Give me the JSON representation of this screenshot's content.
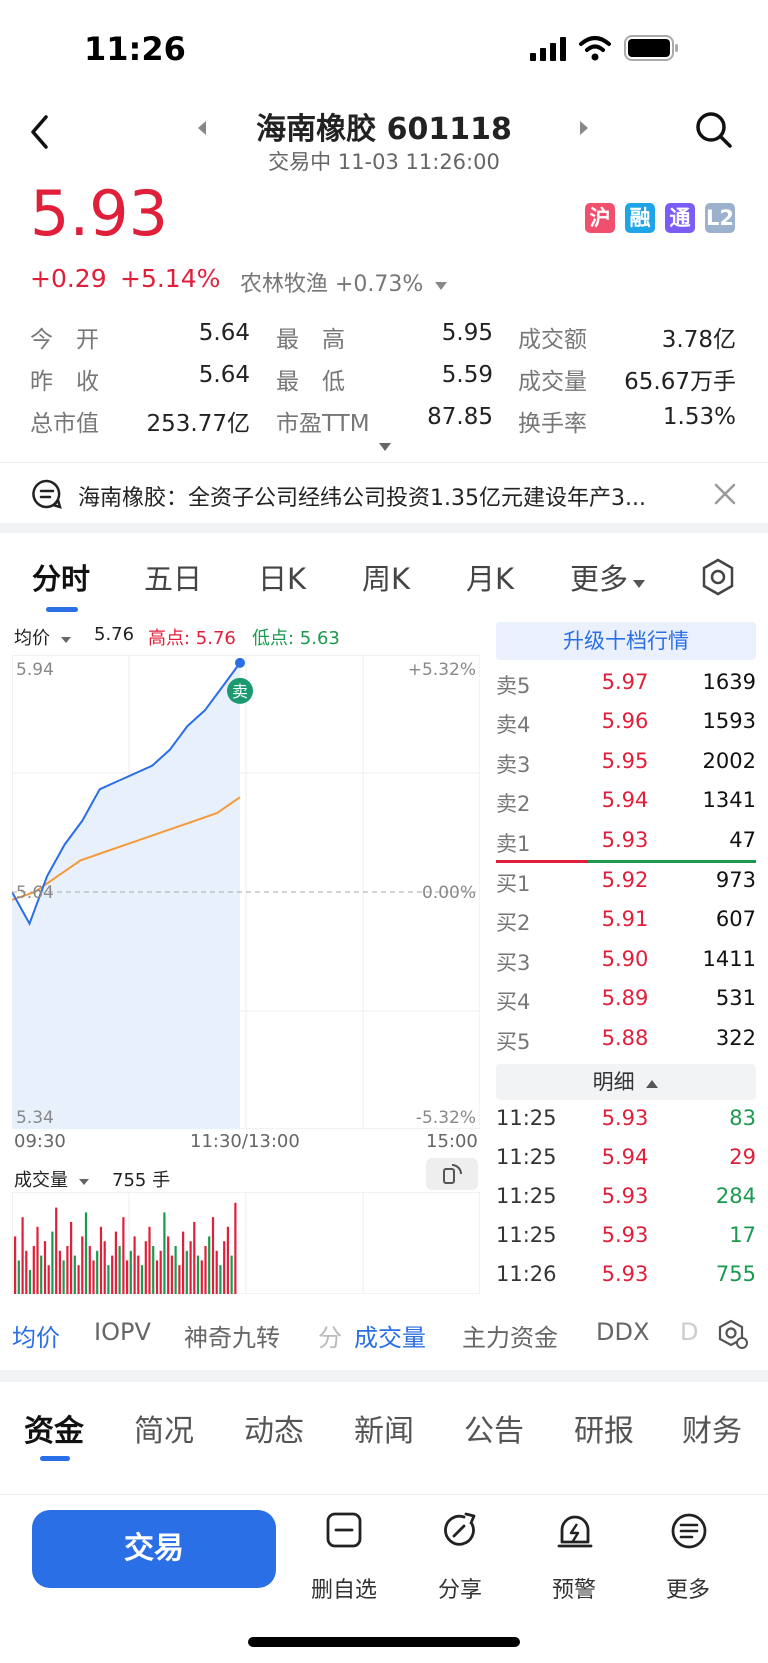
{
  "status_bar": {
    "time": "11:26"
  },
  "header": {
    "title": "海南橡胶 601118",
    "subtitle": "交易中 11-03 11:26:00"
  },
  "badges": [
    {
      "text": "沪",
      "color": "#f0506e"
    },
    {
      "text": "融",
      "color": "#1fa4e8"
    },
    {
      "text": "通",
      "color": "#7b5cf5"
    },
    {
      "text": "L2",
      "color": "#9bb1cc"
    }
  ],
  "quote": {
    "price": "5.93",
    "change": "+0.29",
    "change_pct": "+5.14%",
    "sector": "农林牧渔 +0.73%"
  },
  "stats": [
    {
      "label": "今　开",
      "value": "5.64",
      "color": "#222"
    },
    {
      "label": "最　高",
      "value": "5.95",
      "color": "#e0203a"
    },
    {
      "label": "成交额",
      "value": "3.78亿",
      "color": "#222"
    },
    {
      "label": "昨　收",
      "value": "5.64",
      "color": "#222"
    },
    {
      "label": "最　低",
      "value": "5.59",
      "color": "#1a9a4e"
    },
    {
      "label": "成交量",
      "value": "65.67万手",
      "color": "#222"
    },
    {
      "label": "总市值",
      "value": "253.77亿",
      "color": "#222"
    },
    {
      "label": "市盈TTM",
      "value": "87.85",
      "color": "#222"
    },
    {
      "label": "换手率",
      "value": "1.53%",
      "color": "#222"
    }
  ],
  "news": {
    "text": "海南橡胶：全资子公司经纬公司投资1.35亿元建设年产3..."
  },
  "kline_tabs": [
    "分时",
    "五日",
    "日K",
    "周K",
    "月K",
    "更多"
  ],
  "chart_header": {
    "avg_label": "均价",
    "avg_value": "5.76",
    "high_label": "高点: 5.76",
    "low_label": "低点: 5.63"
  },
  "chart_data": {
    "type": "line",
    "y_left_labels": [
      "5.94",
      "5.64",
      "5.34"
    ],
    "y_right_labels": [
      "+5.32%",
      "0.00%",
      "-5.32%"
    ],
    "x_labels": [
      "09:30",
      "11:30/13:00",
      "15:00"
    ],
    "ylim": [
      5.34,
      5.94
    ],
    "series": [
      {
        "values": [
          5.64,
          5.6,
          5.66,
          5.7,
          5.73,
          5.77,
          5.78,
          5.79,
          5.8,
          5.82,
          5.85,
          5.87,
          5.9,
          5.93
        ],
        "color": "#2b6fe6"
      },
      {
        "values": [
          5.63,
          5.64,
          5.66,
          5.68,
          5.69,
          5.7,
          5.71,
          5.72,
          5.73,
          5.74,
          5.76
        ],
        "color": "#f59a3b"
      }
    ],
    "sell_marker": "卖"
  },
  "volume": {
    "label": "成交量",
    "value": "755 手",
    "bars": [
      0.6,
      0.35,
      0.8,
      0.45,
      0.25,
      0.5,
      0.7,
      0.4,
      0.55,
      0.3,
      0.65,
      0.9,
      0.45,
      0.35,
      0.5,
      0.75,
      0.4,
      0.3,
      0.6,
      0.85,
      0.5,
      0.35,
      0.45,
      0.7,
      0.55,
      0.3,
      0.4,
      0.65,
      0.5,
      0.8,
      0.35,
      0.45,
      0.6,
      0.4,
      0.3,
      0.55,
      0.7,
      0.5,
      0.35,
      0.45,
      0.85,
      0.6,
      0.4,
      0.5,
      0.3,
      0.65,
      0.45,
      0.55,
      0.75,
      0.4,
      0.35,
      0.5,
      0.6,
      0.8,
      0.45,
      0.3,
      0.55,
      0.7,
      0.4,
      0.95
    ]
  },
  "order_book": {
    "upgrade_label": "升级十档行情",
    "asks": [
      {
        "label": "卖5",
        "price": "5.97",
        "vol": "1639"
      },
      {
        "label": "卖4",
        "price": "5.96",
        "vol": "1593"
      },
      {
        "label": "卖3",
        "price": "5.95",
        "vol": "2002"
      },
      {
        "label": "卖2",
        "price": "5.94",
        "vol": "1341"
      },
      {
        "label": "卖1",
        "price": "5.93",
        "vol": "47"
      }
    ],
    "bids": [
      {
        "label": "买1",
        "price": "5.92",
        "vol": "973"
      },
      {
        "label": "买2",
        "price": "5.91",
        "vol": "607"
      },
      {
        "label": "买3",
        "price": "5.90",
        "vol": "1411"
      },
      {
        "label": "买4",
        "price": "5.89",
        "vol": "531"
      },
      {
        "label": "买5",
        "price": "5.88",
        "vol": "322"
      }
    ]
  },
  "trades": {
    "header": "明细",
    "rows": [
      {
        "time": "11:25",
        "price": "5.93",
        "vol": "83",
        "color": "#1a9a4e"
      },
      {
        "time": "11:25",
        "price": "5.94",
        "vol": "29",
        "color": "#e0203a"
      },
      {
        "time": "11:25",
        "price": "5.93",
        "vol": "284",
        "color": "#1a9a4e"
      },
      {
        "time": "11:25",
        "price": "5.93",
        "vol": "17",
        "color": "#1a9a4e"
      },
      {
        "time": "11:26",
        "price": "5.93",
        "vol": "755",
        "color": "#1a9a4e"
      }
    ]
  },
  "indicator_tabs": [
    "均价",
    "IOPV",
    "神奇九转",
    "分",
    "成交量",
    "主力资金",
    "DDX",
    "D"
  ],
  "bottom_tabs": [
    "资金",
    "简况",
    "动态",
    "新闻",
    "公告",
    "研报",
    "财务"
  ],
  "bottom_bar": {
    "trade_label": "交易",
    "actions": [
      "删自选",
      "分享",
      "预警",
      "更多"
    ]
  }
}
